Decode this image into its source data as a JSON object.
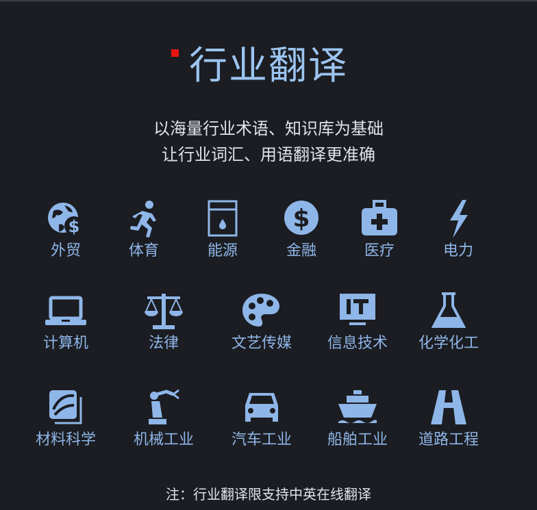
{
  "title": "行业翻译",
  "subtitle_lines": [
    "以海量行业术语、知识库为基础",
    "让行业词汇、用语翻译更准确"
  ],
  "accent_color": "#9cc4f0",
  "mark_color": "#e8140f",
  "industries": [
    {
      "label": "外贸",
      "icon": "globe-dollar-icon"
    },
    {
      "label": "体育",
      "icon": "runner-icon"
    },
    {
      "label": "能源",
      "icon": "energy-box-icon"
    },
    {
      "label": "金融",
      "icon": "dollar-coin-icon"
    },
    {
      "label": "医疗",
      "icon": "medical-kit-icon"
    },
    {
      "label": "电力",
      "icon": "lightning-bolt-icon"
    },
    {
      "label": "计算机",
      "icon": "laptop-icon"
    },
    {
      "label": "法律",
      "icon": "scales-icon"
    },
    {
      "label": "文艺传媒",
      "icon": "palette-icon"
    },
    {
      "label": "信息技术",
      "icon": "it-monitor-icon"
    },
    {
      "label": "化学化工",
      "icon": "flask-icon"
    },
    {
      "label": "材料科学",
      "icon": "material-sample-icon"
    },
    {
      "label": "机械工业",
      "icon": "robot-arm-icon"
    },
    {
      "label": "汽车工业",
      "icon": "car-icon"
    },
    {
      "label": "船舶工业",
      "icon": "ship-icon"
    },
    {
      "label": "道路工程",
      "icon": "road-icon"
    }
  ],
  "note": "注：行业翻译限支持中英在线翻译"
}
